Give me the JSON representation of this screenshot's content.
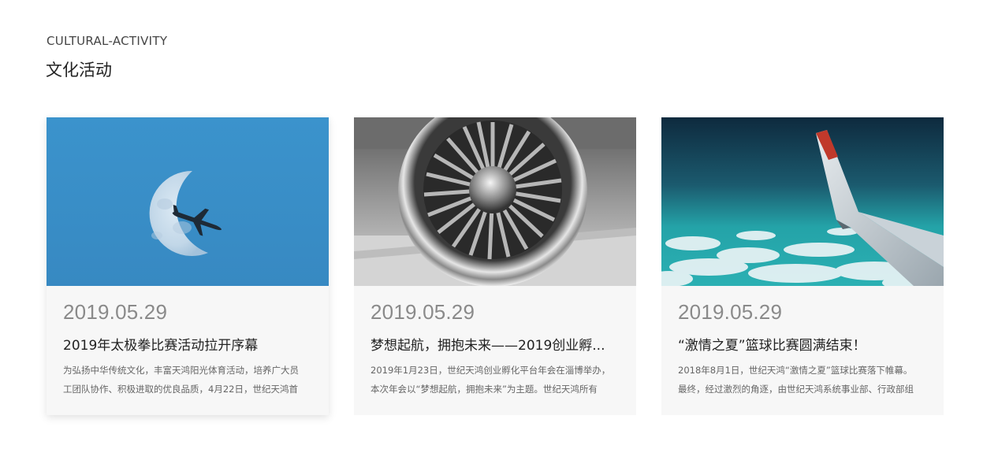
{
  "header": {
    "subtitle": "CULTURAL-ACTIVITY",
    "title": "文化活动"
  },
  "cards": [
    {
      "date": "2019.05.29",
      "title": "2019年太极拳比赛活动拉开序幕",
      "excerpt_line1": "为弘扬中华传统文化，丰富天鸿阳光体育活动，培养广大员",
      "excerpt_line2": "工团队协作、积极进取的优良品质，4月22日，世纪天鸿首",
      "image": "airplane-moon-photo"
    },
    {
      "date": "2019.05.29",
      "title": "梦想起航，拥抱未来——2019创业孵...",
      "excerpt_line1": "2019年1月23日，世纪天鸿创业孵化平台年会在淄博举办，",
      "excerpt_line2": "本次年会以“梦想起航，拥抱未来”为主题。世纪天鸿所有",
      "image": "jet-engine-photo"
    },
    {
      "date": "2019.05.29",
      "title": "“激情之夏”篮球比赛圆满结束！",
      "excerpt_line1": "2018年8月1日，世纪天鸿“激情之夏”篮球比赛落下帷幕。",
      "excerpt_line2": "最终，经过激烈的角逐，由世纪天鸿系统事业部、行政部组",
      "image": "airplane-wing-clouds-photo"
    }
  ],
  "colors": {
    "card_bg": "#f7f7f7",
    "date": "#8a8a8a",
    "sky_blue": "#3a8fc8"
  }
}
